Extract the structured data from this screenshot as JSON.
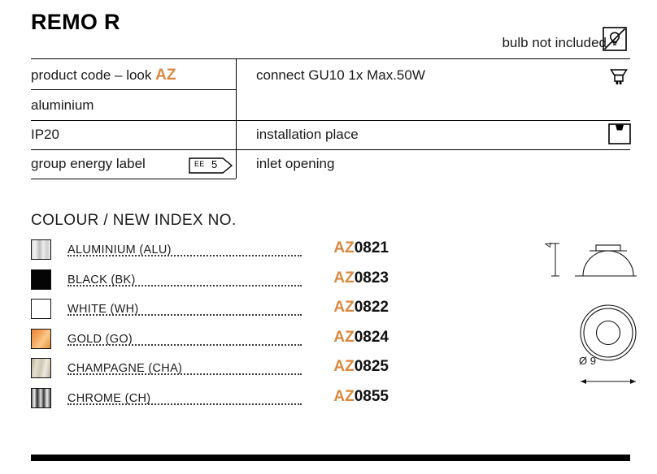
{
  "title": "REMO R",
  "bulb_note": {
    "text": "bulb not included",
    "icon": "bulb-crossed-icon"
  },
  "spec_table": {
    "left_column": [
      {
        "label": "product code – look ",
        "highlight": "AZ"
      },
      {
        "label": "aluminium"
      },
      {
        "label": "IP20"
      },
      {
        "label": "group energy label",
        "badge": {
          "prefix": "EE",
          "value": "5"
        }
      }
    ],
    "right_column": [
      {
        "label": "connect GU10 1x Max.50W",
        "icon": "gu10-bulb-icon"
      },
      {
        "label": "installation place",
        "icon": "installation-place-icon"
      },
      {
        "label": "inlet opening"
      }
    ]
  },
  "colour_section": {
    "heading": "COLOUR / NEW INDEX NO.",
    "items": [
      {
        "name": "ALUMINIUM (ALU)",
        "prefix": "AZ",
        "number": "0821",
        "swatch": "aluminium"
      },
      {
        "name": "BLACK (BK)",
        "prefix": "AZ",
        "number": "0823",
        "swatch": "black"
      },
      {
        "name": "WHITE (WH)",
        "prefix": "AZ",
        "number": "0822",
        "swatch": "white"
      },
      {
        "name": "GOLD (GO)",
        "prefix": "AZ",
        "number": "0824",
        "swatch": "gold"
      },
      {
        "name": "CHAMPAGNE (CHA)",
        "prefix": "AZ",
        "number": "0825",
        "swatch": "champagne"
      },
      {
        "name": "CHROME (CH)",
        "prefix": "AZ",
        "number": "0855",
        "swatch": "chrome"
      }
    ]
  },
  "drawings": {
    "height_dimension": "4",
    "diameter_dimension": "Ø 9"
  },
  "colors": {
    "accent_orange": "#d9883f",
    "text": "#1a1a1a",
    "rule": "#000000"
  }
}
